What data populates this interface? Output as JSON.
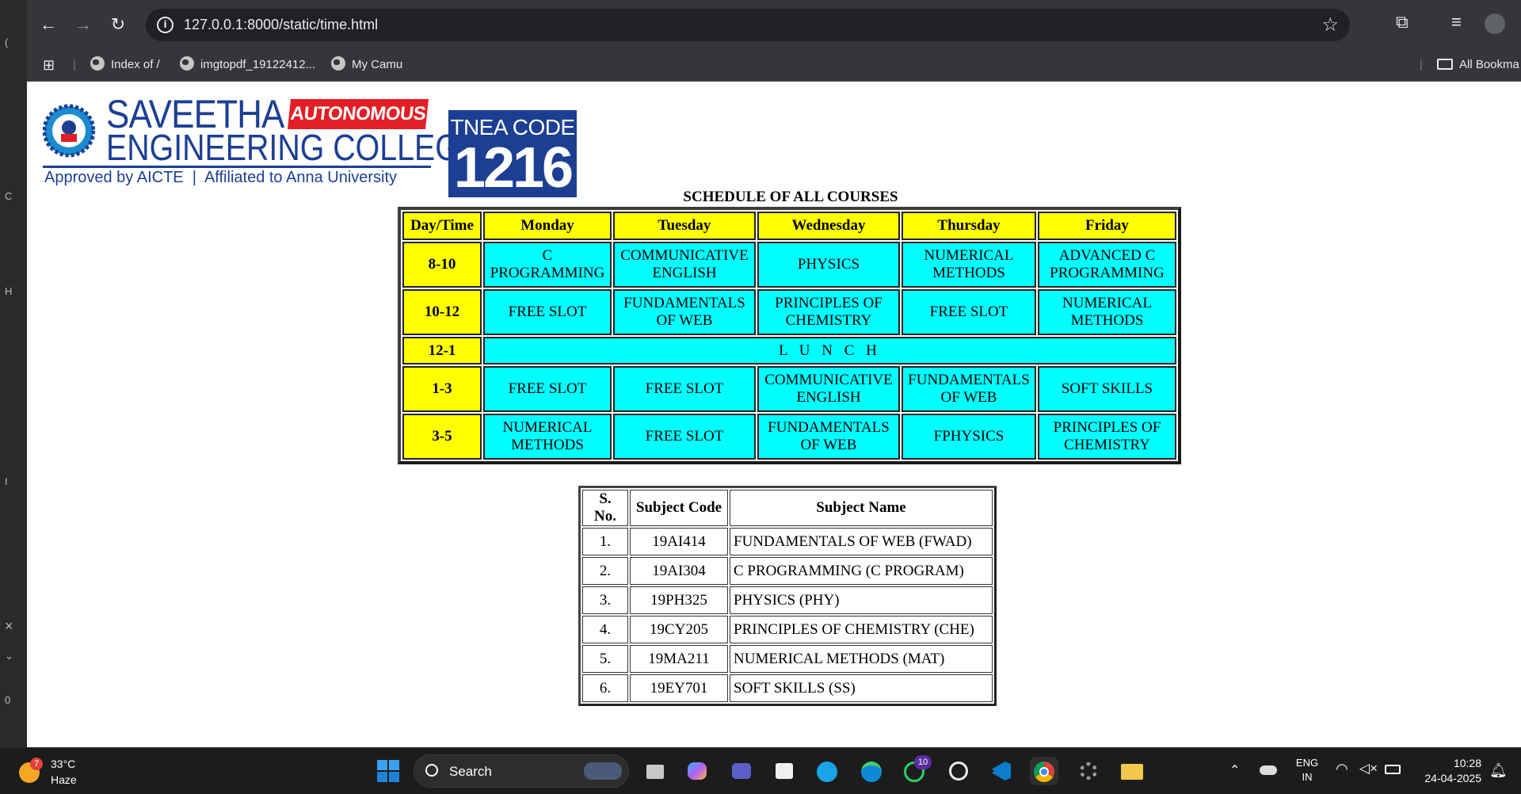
{
  "browser": {
    "url": "127.0.0.1:8000/static/time.html",
    "bookmarks": [
      {
        "label": "Index of /"
      },
      {
        "label": "imgtopdf_19122412..."
      },
      {
        "label": "My Camu"
      }
    ],
    "all_bookmarks": "All Bookma"
  },
  "page": {
    "logo": {
      "name_line1": "SAVEETHA",
      "badge": "AUTONOMOUS",
      "name_line2": "ENGINEERING COLLEGE",
      "tagline": "Approved by AICTE  |  Affiliated to Anna University",
      "tnea_label": "TNEA CODE",
      "tnea_code": "1216"
    },
    "schedule": {
      "title": "SCHEDULE OF ALL COURSES",
      "headers": [
        "Day/Time",
        "Monday",
        "Tuesday",
        "Wednesday",
        "Thursday",
        "Friday"
      ],
      "rows": [
        {
          "time": "8-10",
          "cells": [
            "C PROGRAMMING",
            "COMMUNICATIVE ENGLISH",
            "PHYSICS",
            "NUMERICAL METHODS",
            "ADVANCED C PROGRAMMING"
          ]
        },
        {
          "time": "10-12",
          "cells": [
            "FREE SLOT",
            "FUNDAMENTALS OF WEB",
            "PRINCIPLES OF CHEMISTRY",
            "FREE SLOT",
            "NUMERICAL METHODS"
          ]
        },
        {
          "time": "12-1",
          "lunch": "L U N C H"
        },
        {
          "time": "1-3",
          "cells": [
            "FREE SLOT",
            "FREE SLOT",
            "COMMUNICATIVE ENGLISH",
            "FUNDAMENTALS OF WEB",
            "SOFT SKILLS"
          ]
        },
        {
          "time": "3-5",
          "cells": [
            "NUMERICAL METHODS",
            "FREE SLOT",
            "FUNDAMENTALS OF WEB",
            "FPHYSICS",
            "PRINCIPLES OF CHEMISTRY"
          ]
        }
      ]
    },
    "subjects": {
      "headers": [
        "S. No.",
        "Subject Code",
        "Subject Name"
      ],
      "rows": [
        {
          "sno": "1.",
          "code": "19AI414",
          "name": "FUNDAMENTALS OF WEB (FWAD)"
        },
        {
          "sno": "2.",
          "code": "19AI304",
          "name": "C PROGRAMMING (C PROGRAM)"
        },
        {
          "sno": "3.",
          "code": "19PH325",
          "name": "PHYSICS (PHY)"
        },
        {
          "sno": "4.",
          "code": "19CY205",
          "name": "PRINCIPLES OF CHEMISTRY (CHE)"
        },
        {
          "sno": "5.",
          "code": "19MA211",
          "name": "NUMERICAL METHODS (MAT)"
        },
        {
          "sno": "6.",
          "code": "19EY701",
          "name": "SOFT SKILLS (SS)"
        }
      ]
    }
  },
  "taskbar": {
    "weather_temp": "33°C",
    "weather_desc": "Haze",
    "weather_badge": "7",
    "search_placeholder": "Search",
    "whatsapp_badge": "10",
    "lang_line1": "ENG",
    "lang_line2": "IN",
    "time": "10:28",
    "date": "24-04-2025",
    "colors": {
      "start": "#0078d4",
      "chrome": "#4285f4",
      "vscode": "#0a7ecd",
      "whatsapp": "#25d366",
      "edge": "#0c8ad8"
    }
  }
}
